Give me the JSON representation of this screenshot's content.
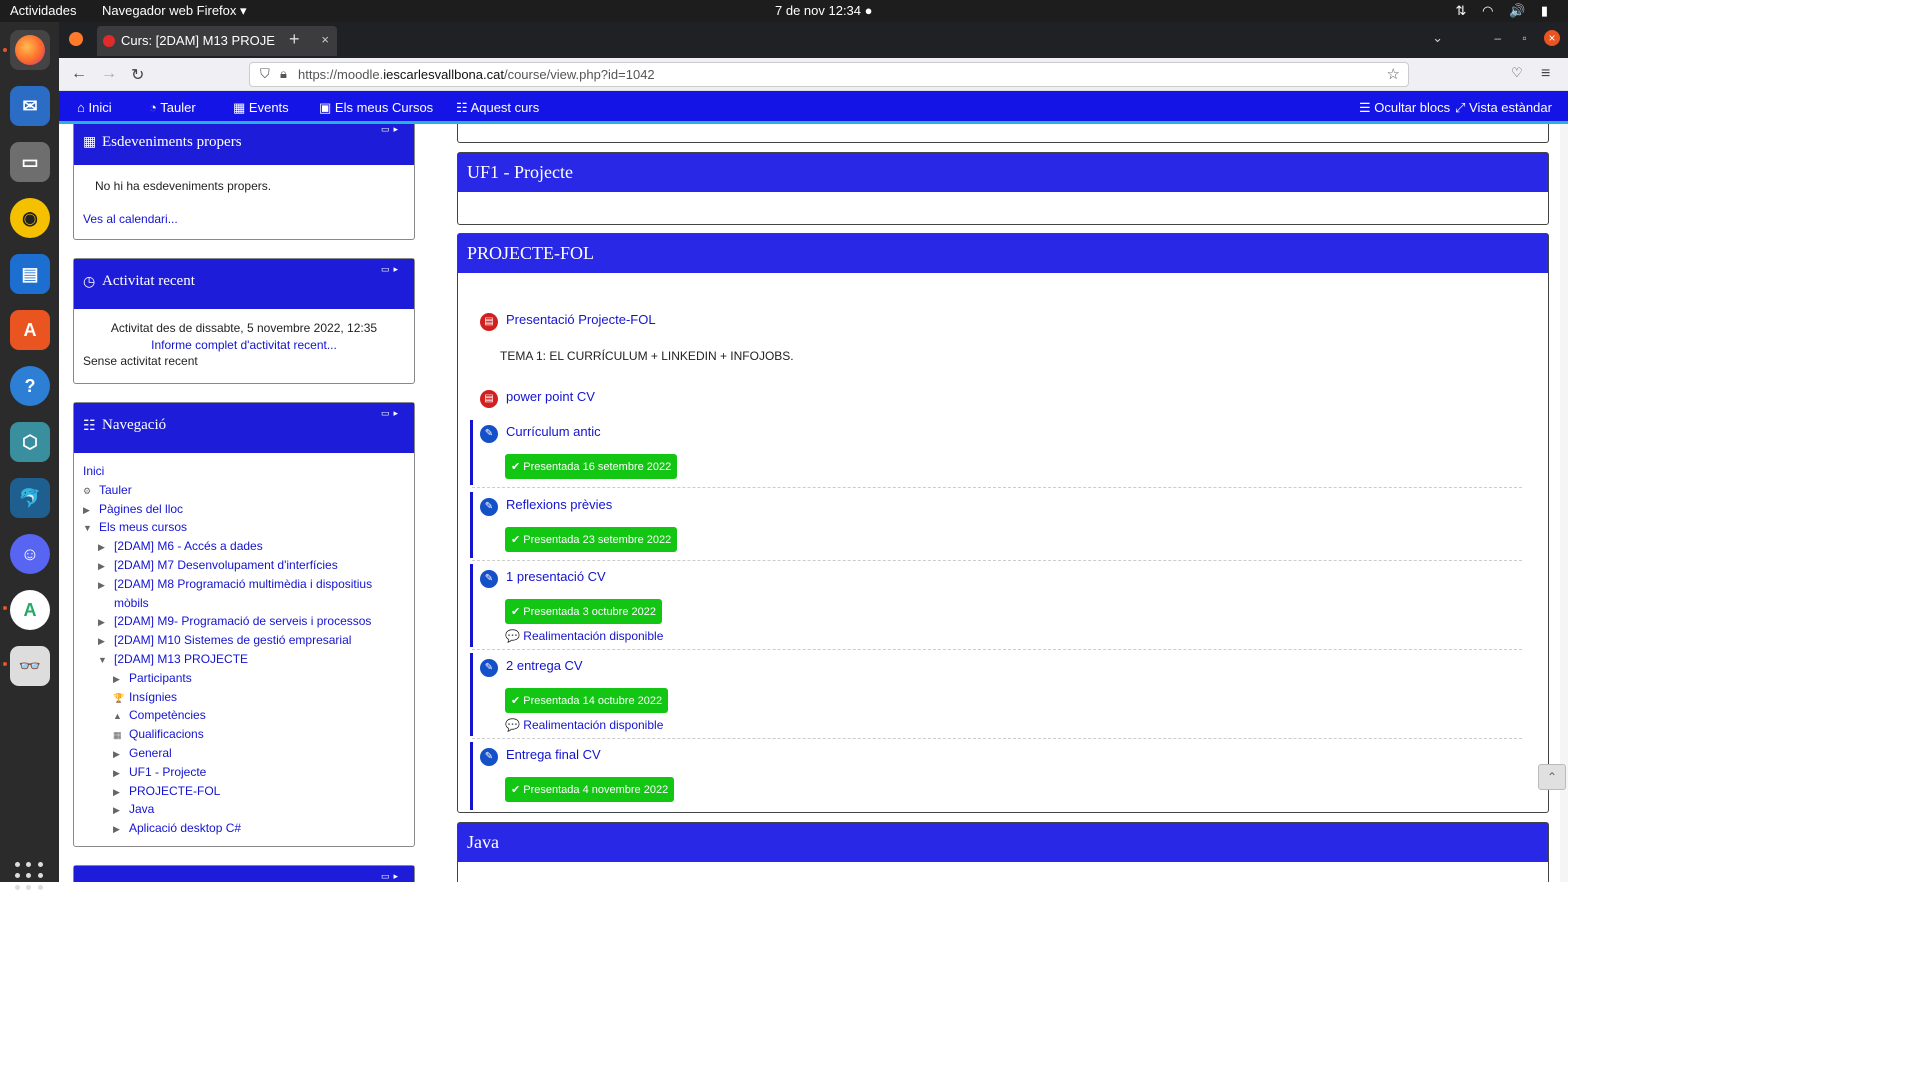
{
  "os": {
    "activities": "Actividades",
    "app_menu": "Navegador web Firefox ▾",
    "clock": "7 de nov  12:34  ●"
  },
  "browser": {
    "tab_title": "Curs: [2DAM] M13 PROJE",
    "tab_close": "×",
    "new_tab": "+",
    "url_prefix": "https://moodle.",
    "url_domain": "iescarlesvallbona.cat",
    "url_path": "/course/view.php?id=1042"
  },
  "mainnav": {
    "home": "Inici",
    "dashboard": "Tauler",
    "events": "Events",
    "my_courses": "Els meus Cursos",
    "this_course": "Aquest curs",
    "hide_blocks": "Ocultar blocs",
    "standard_view": "Vista estàndar"
  },
  "upcoming": {
    "title": "Esdeveniments propers",
    "empty": "No hi ha esdeveniments propers.",
    "calendar_link": "Ves al calendari..."
  },
  "recent": {
    "title": "Activitat recent",
    "since": "Activitat des de dissabte, 5 novembre 2022, 12:35",
    "report_link": "Informe complet d'activitat recent...",
    "none": "Sense activitat recent"
  },
  "navigation": {
    "title": "Navegació",
    "items": [
      {
        "label": "Inici",
        "level": 0,
        "marker": ""
      },
      {
        "label": "Tauler",
        "level": 0,
        "marker": "⚙"
      },
      {
        "label": "Pàgines del lloc",
        "level": 0,
        "marker": "▶"
      },
      {
        "label": "Els meus cursos",
        "level": 0,
        "marker": "▼"
      },
      {
        "label": "[2DAM] M6 - Accés a dades",
        "level": 1,
        "marker": "▶"
      },
      {
        "label": "[2DAM] M7 Desenvolupament d'interfícies",
        "level": 1,
        "marker": "▶"
      },
      {
        "label": "[2DAM] M8 Programació multimèdia i dispositius",
        "level": 1,
        "marker": "▶"
      },
      {
        "label": "mòbils",
        "level": 1,
        "marker": ""
      },
      {
        "label": "[2DAM] M9- Programació de serveis i processos",
        "level": 1,
        "marker": "▶"
      },
      {
        "label": "[2DAM] M10 Sistemes de gestió empresarial",
        "level": 1,
        "marker": "▶"
      },
      {
        "label": "[2DAM] M13 PROJECTE",
        "level": 1,
        "marker": "▼"
      },
      {
        "label": "Participants",
        "level": 2,
        "marker": "▶"
      },
      {
        "label": "Insígnies",
        "level": 2,
        "marker": "🏆"
      },
      {
        "label": "Competències",
        "level": 2,
        "marker": "▲"
      },
      {
        "label": "Qualificacions",
        "level": 2,
        "marker": "▦"
      },
      {
        "label": "General",
        "level": 2,
        "marker": "▶"
      },
      {
        "label": "UF1 - Projecte",
        "level": 2,
        "marker": "▶"
      },
      {
        "label": "PROJECTE-FOL",
        "level": 2,
        "marker": "▶"
      },
      {
        "label": "Java",
        "level": 2,
        "marker": "▶"
      },
      {
        "label": "Aplicació desktop C#",
        "level": 2,
        "marker": "▶"
      }
    ]
  },
  "sections": {
    "uf1": {
      "title": "UF1 - Projecte"
    },
    "fol": {
      "title": "PROJECTE-FOL",
      "pres": "Presentació Projecte-FOL",
      "tema": "TEMA 1: EL CURRÍCULUM + LINKEDIN + INFOJOBS.",
      "ppt": "power point CV",
      "assignments": [
        {
          "name": "Currículum antic",
          "status": "✔ Presentada 16 setembre 2022",
          "feedback": ""
        },
        {
          "name": "Reflexions prèvies",
          "status": "✔ Presentada 23 setembre 2022",
          "feedback": ""
        },
        {
          "name": "1 presentació CV",
          "status": "✔ Presentada 3 octubre 2022",
          "feedback": "💬 Realimentación disponible"
        },
        {
          "name": "2 entrega CV",
          "status": "✔ Presentada 14 octubre 2022",
          "feedback": "💬 Realimentación disponible"
        },
        {
          "name": "Entrega final CV",
          "status": "✔ Presentada 4 novembre 2022",
          "feedback": ""
        }
      ]
    },
    "java": {
      "title": "Java"
    }
  },
  "colors": {
    "moodle_blue": "#1414e6",
    "success": "#13c613"
  }
}
